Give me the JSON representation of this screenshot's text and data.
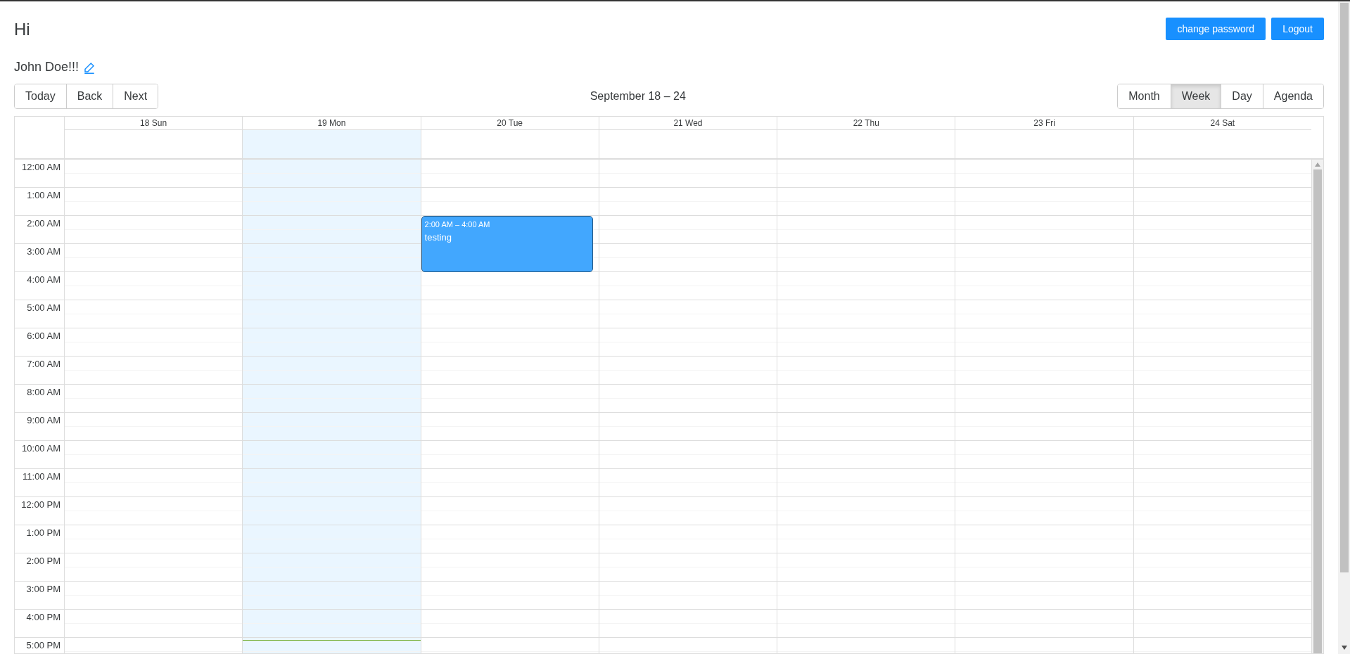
{
  "greeting": "Hi",
  "header_buttons": [
    {
      "label": "change password"
    },
    {
      "label": "Logout"
    }
  ],
  "user_name": "John Doe!!!",
  "nav_buttons": [
    {
      "label": "Today"
    },
    {
      "label": "Back"
    },
    {
      "label": "Next"
    }
  ],
  "range_label": "September 18 – 24",
  "views": [
    {
      "label": "Month",
      "selected": false
    },
    {
      "label": "Week",
      "selected": true
    },
    {
      "label": "Day",
      "selected": false
    },
    {
      "label": "Agenda",
      "selected": false
    }
  ],
  "days": [
    {
      "label": "18 Sun",
      "today": false
    },
    {
      "label": "19 Mon",
      "today": true
    },
    {
      "label": "20 Tue",
      "today": false,
      "events": [
        {
          "time": "2:00 AM – 4:00 AM",
          "title": "testing"
        }
      ]
    },
    {
      "label": "21 Wed",
      "today": false
    },
    {
      "label": "22 Thu",
      "today": false
    },
    {
      "label": "23 Fri",
      "today": false
    },
    {
      "label": "24 Sat",
      "today": false
    }
  ],
  "hours": [
    "12:00 AM",
    "1:00 AM",
    "2:00 AM",
    "3:00 AM",
    "4:00 AM",
    "5:00 AM",
    "6:00 AM",
    "7:00 AM",
    "8:00 AM",
    "9:00 AM",
    "10:00 AM",
    "11:00 AM",
    "12:00 PM",
    "1:00 PM",
    "2:00 PM",
    "3:00 PM",
    "4:00 PM",
    "5:00 PM"
  ]
}
